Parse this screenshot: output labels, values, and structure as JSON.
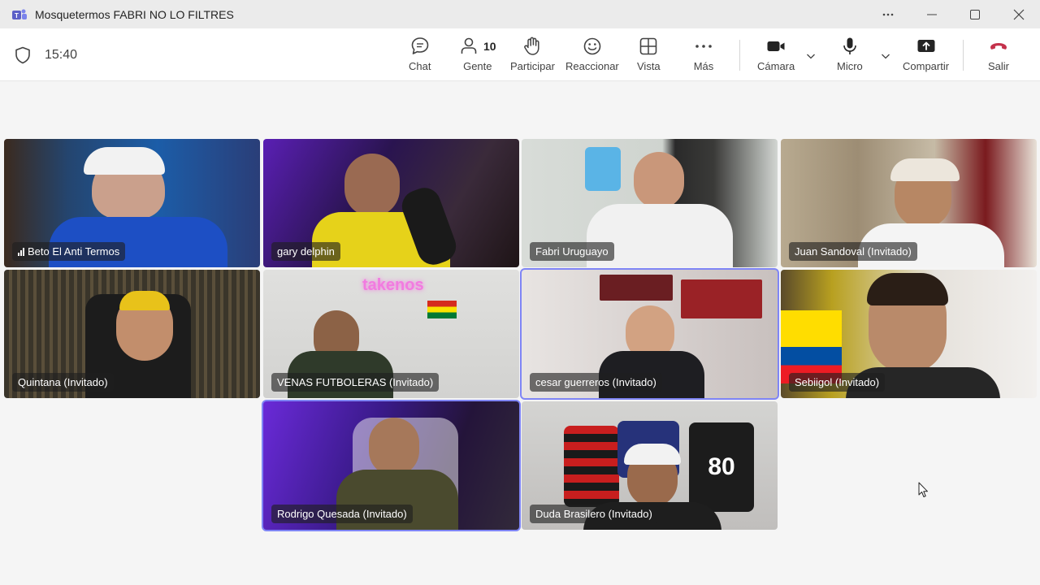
{
  "window": {
    "title": "Mosquetermos FABRI NO LO FILTRES",
    "more_icon": "more-horizontal-icon",
    "minimize_icon": "minimize-icon",
    "maximize_icon": "maximize-icon",
    "close_icon": "close-icon"
  },
  "toolbar": {
    "timer": "15:40",
    "chat": "Chat",
    "people": "Gente",
    "people_count": "10",
    "raise_hand": "Participar",
    "react": "Reaccionar",
    "view": "Vista",
    "more": "Más",
    "camera": "Cámara",
    "mic": "Micro",
    "share": "Compartir",
    "leave": "Salir",
    "leave_color": "#c4314b",
    "accent": "#7f85f5"
  },
  "participants": [
    {
      "name": "Beto El Anti Termos",
      "signal": true
    },
    {
      "name": "gary delphin"
    },
    {
      "name": "Fabri Uruguayo"
    },
    {
      "name": "Juan Sandoval (Invitado)"
    },
    {
      "name": "Quintana (Invitado)"
    },
    {
      "name": "VENAS FUTBOLERAS (Invitado)",
      "sign": "takenos"
    },
    {
      "name": "cesar guerreros (Invitado)",
      "active": true
    },
    {
      "name": "Sebiigol (Invitado)"
    },
    {
      "name": "Rodrigo Quesada (Invitado)",
      "active": true
    },
    {
      "name": "Duda Brasilero (Invitado)",
      "jersey_number": "80"
    }
  ]
}
